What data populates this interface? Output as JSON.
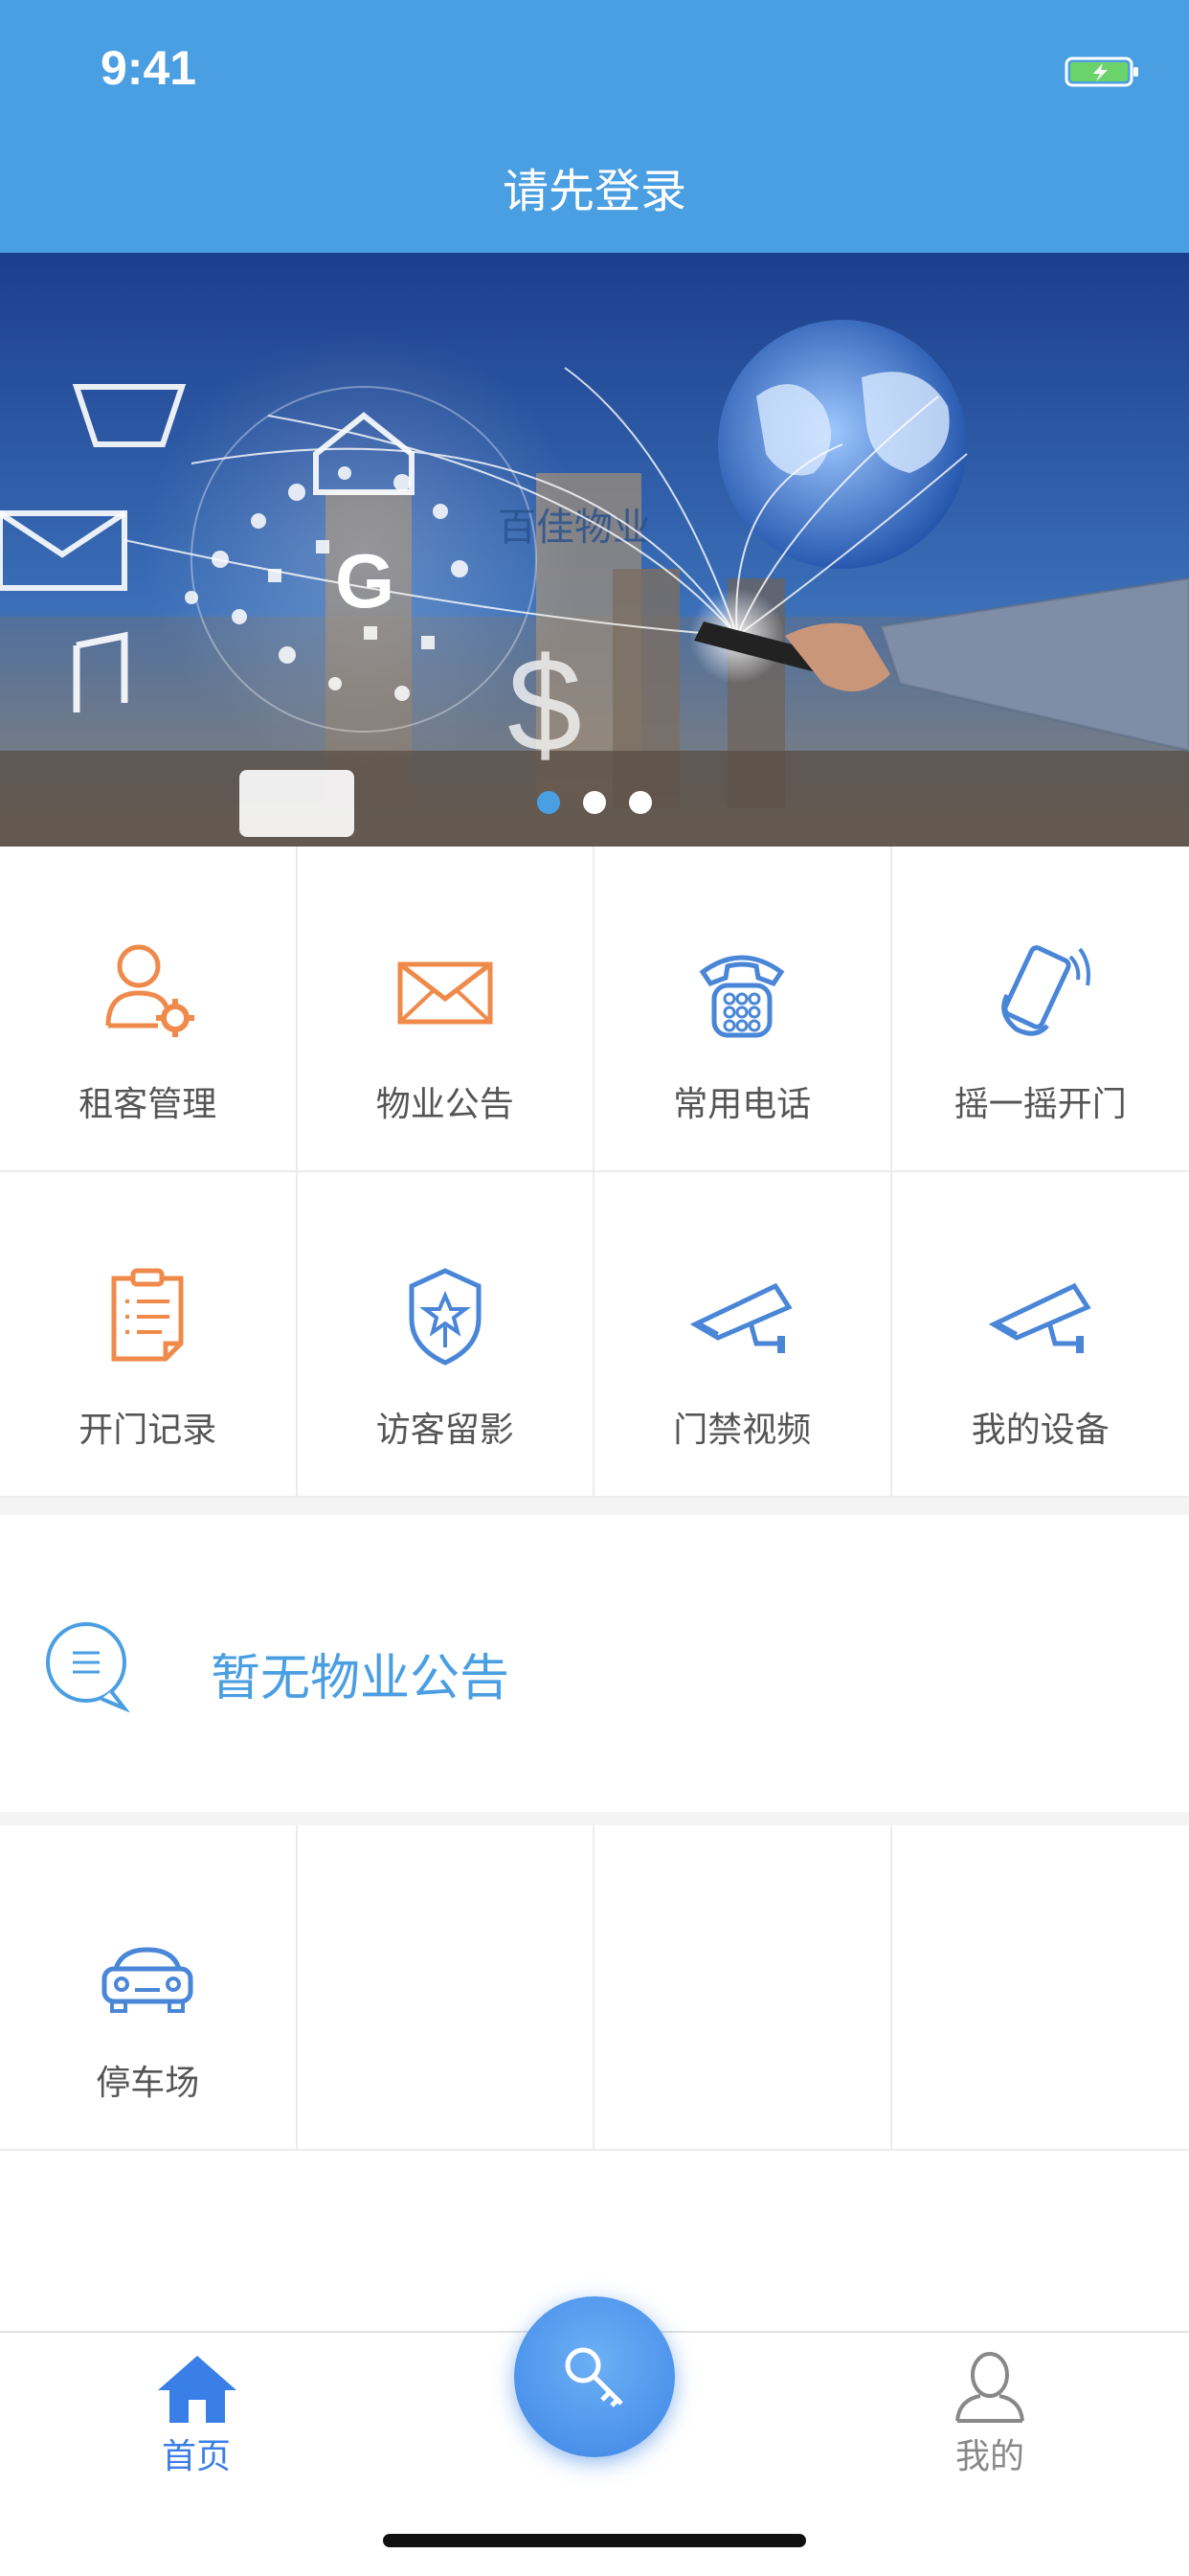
{
  "status_bar": {
    "time": "9:41"
  },
  "header": {
    "title": "请先登录"
  },
  "banner": {
    "logo_text": "百佳物业",
    "active_index": 0,
    "total": 3
  },
  "menu": {
    "items": [
      {
        "label": "租客管理",
        "icon": "tenant-icon"
      },
      {
        "label": "物业公告",
        "icon": "envelope-icon"
      },
      {
        "label": "常用电话",
        "icon": "phone-icon"
      },
      {
        "label": "摇一摇开门",
        "icon": "shake-phone-icon"
      },
      {
        "label": "开门记录",
        "icon": "clipboard-icon"
      },
      {
        "label": "访客留影",
        "icon": "shield-icon"
      },
      {
        "label": "门禁视频",
        "icon": "camera-icon"
      },
      {
        "label": "我的设备",
        "icon": "camera-icon"
      }
    ]
  },
  "notice": {
    "text": "暂无物业公告"
  },
  "extra_menu": {
    "items": [
      {
        "label": "停车场",
        "icon": "car-icon"
      }
    ]
  },
  "tabbar": {
    "home_label": "首页",
    "mine_label": "我的",
    "colors": {
      "active": "#3a7ee8",
      "inactive": "#888888"
    }
  },
  "colors": {
    "brand": "#4a9ee2",
    "orange": "#f08a4b",
    "blue_icon": "#4a86d8"
  }
}
